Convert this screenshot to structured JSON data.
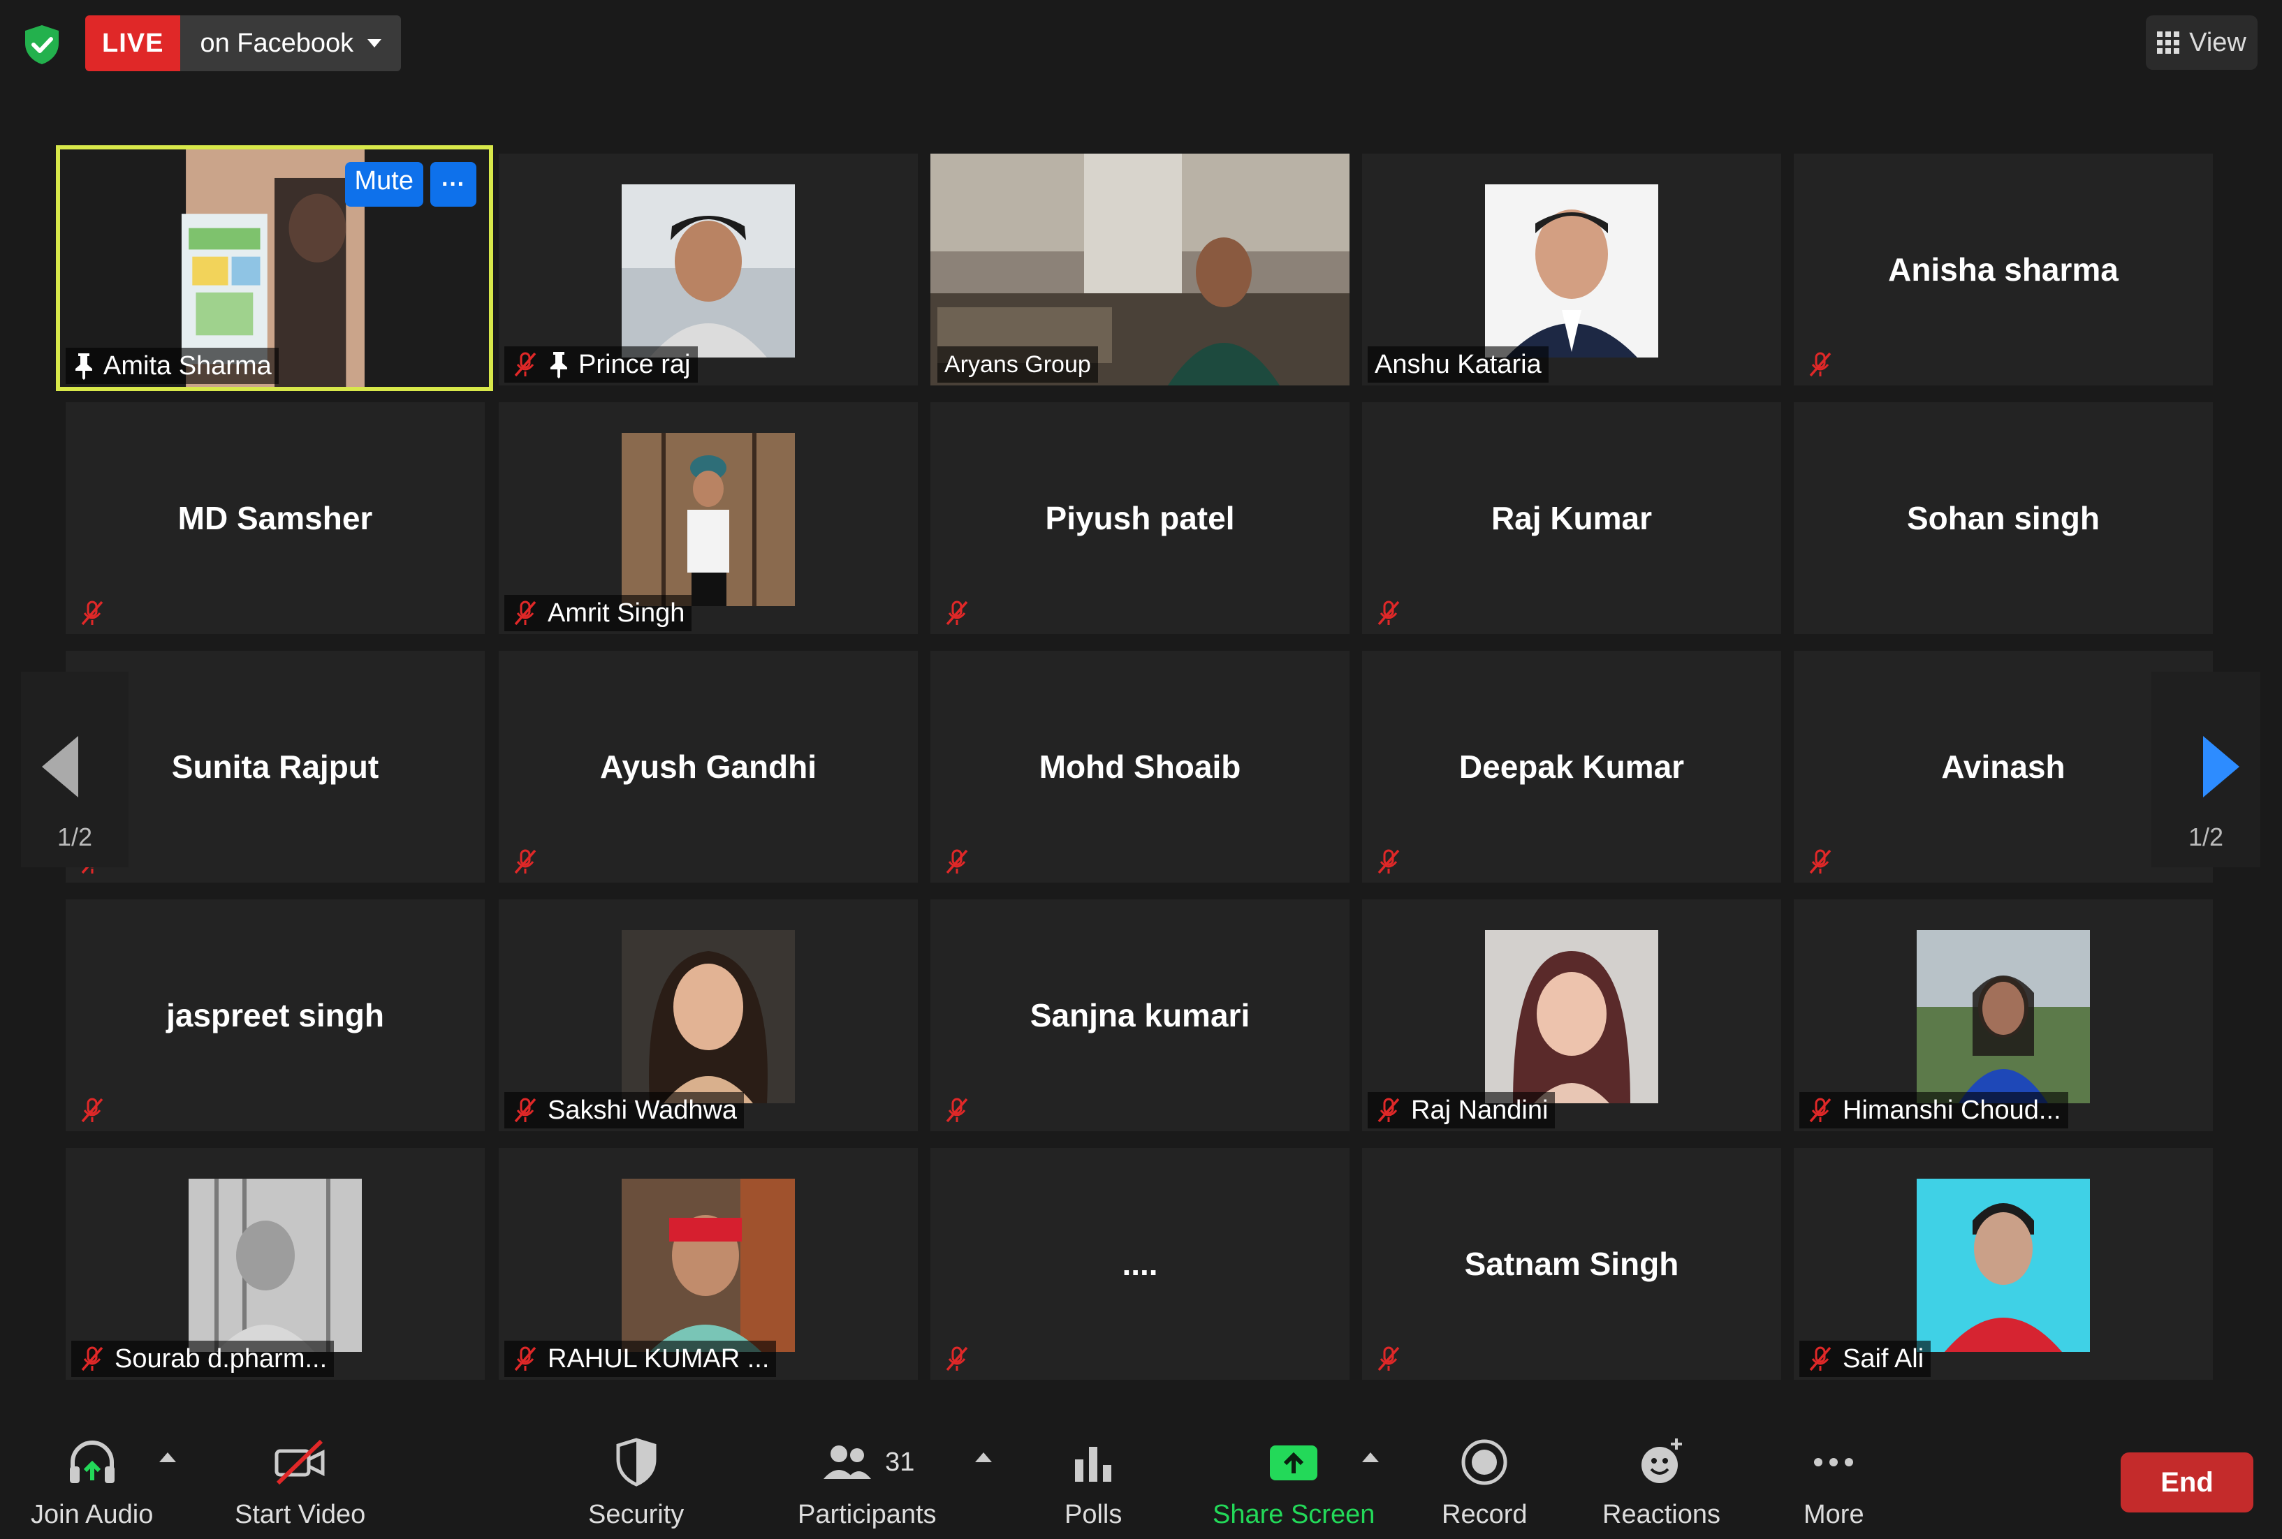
{
  "topbar": {
    "live_label": "LIVE",
    "destination_label": "on Facebook",
    "view_label": "View"
  },
  "pager": {
    "left_label": "1/2",
    "right_label": "1/2"
  },
  "tiles": [
    {
      "id": "amita",
      "name": "Amita Sharma",
      "kind": "video",
      "muted": false,
      "pinned": true,
      "active": true
    },
    {
      "id": "prince",
      "name": "Prince raj",
      "kind": "photo",
      "muted": true,
      "pinned": true
    },
    {
      "id": "aryans",
      "name": "Aryans Group",
      "kind": "video",
      "muted": false
    },
    {
      "id": "anshu",
      "name": "Anshu Kataria",
      "kind": "photo",
      "muted": false
    },
    {
      "id": "anisha",
      "name": "Anisha sharma",
      "kind": "name",
      "muted": true
    },
    {
      "id": "samsher",
      "name": "MD Samsher",
      "kind": "name",
      "muted": true
    },
    {
      "id": "amrit",
      "name": "Amrit Singh",
      "kind": "photo",
      "muted": true
    },
    {
      "id": "piyush",
      "name": "Piyush patel",
      "kind": "name",
      "muted": true
    },
    {
      "id": "rajkumar",
      "name": "Raj Kumar",
      "kind": "name",
      "muted": true
    },
    {
      "id": "sohan",
      "name": "Sohan singh",
      "kind": "name",
      "muted": false
    },
    {
      "id": "sunita",
      "name": "Sunita Rajput",
      "kind": "name",
      "muted": true
    },
    {
      "id": "ayush",
      "name": "Ayush Gandhi",
      "kind": "name",
      "muted": true
    },
    {
      "id": "shoaib",
      "name": "Mohd Shoaib",
      "kind": "name",
      "muted": true
    },
    {
      "id": "deepak",
      "name": "Deepak Kumar",
      "kind": "name",
      "muted": true
    },
    {
      "id": "avinash",
      "name": "Avinash",
      "kind": "name",
      "muted": true
    },
    {
      "id": "jaspreet",
      "name": "jaspreet singh",
      "kind": "name",
      "muted": true
    },
    {
      "id": "sakshi",
      "name": "Sakshi Wadhwa",
      "kind": "photo",
      "muted": true
    },
    {
      "id": "sanjna",
      "name": "Sanjna kumari",
      "kind": "name",
      "muted": true
    },
    {
      "id": "rajnandini",
      "name": "Raj Nandini",
      "kind": "photo",
      "muted": true
    },
    {
      "id": "himanshi",
      "name": "Himanshi Choud...",
      "kind": "photo",
      "muted": true
    },
    {
      "id": "sourab",
      "name": "Sourab d.pharm...",
      "kind": "photo",
      "muted": true
    },
    {
      "id": "rahul",
      "name": "RAHUL KUMAR ...",
      "kind": "photo",
      "muted": true
    },
    {
      "id": "dots",
      "name": "....",
      "kind": "name",
      "muted": true
    },
    {
      "id": "satnam",
      "name": "Satnam Singh",
      "kind": "name",
      "muted": true
    },
    {
      "id": "saif",
      "name": "Saif Ali",
      "kind": "photo",
      "muted": true
    }
  ],
  "hover_controls": {
    "mute_label": "Mute",
    "more_label": "···"
  },
  "toolbar": {
    "join_audio": "Join Audio",
    "start_video": "Start Video",
    "security": "Security",
    "participants": "Participants",
    "participant_count": "31",
    "polls": "Polls",
    "share_screen": "Share Screen",
    "record": "Record",
    "reactions": "Reactions",
    "more": "More",
    "end": "End"
  },
  "colors": {
    "live_red": "#e02828",
    "active_outline": "#d8e84a",
    "accent_blue": "#0e71eb",
    "share_green": "#23d959",
    "end_red": "#c42b2b",
    "muted_red": "#e02828"
  }
}
